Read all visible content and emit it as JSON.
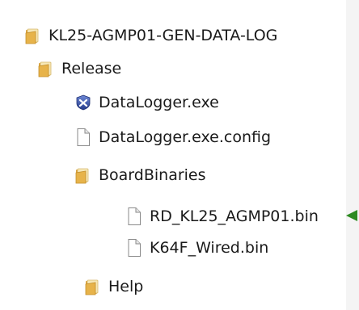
{
  "tree": {
    "root": {
      "label": "KL25-AGMP01-GEN-DATA-LOG",
      "icon": "folder-icon"
    },
    "release": {
      "label": "Release",
      "icon": "folder-icon"
    },
    "datalogger_exe": {
      "label": "DataLogger.exe",
      "icon": "application-icon"
    },
    "datalogger_config": {
      "label": "DataLogger.exe.config",
      "icon": "file-icon"
    },
    "board_binaries": {
      "label": "BoardBinaries",
      "icon": "folder-icon"
    },
    "rd_kl25_bin": {
      "label": "RD_KL25_AGMP01.bin",
      "icon": "file-icon"
    },
    "k64f_wired_bin": {
      "label": "K64F_Wired.bin",
      "icon": "file-icon"
    },
    "help": {
      "label": "Help",
      "icon": "folder-icon"
    }
  },
  "annotation": {
    "icon": "arrow-pointer-icon",
    "color": "#2e8b22"
  }
}
